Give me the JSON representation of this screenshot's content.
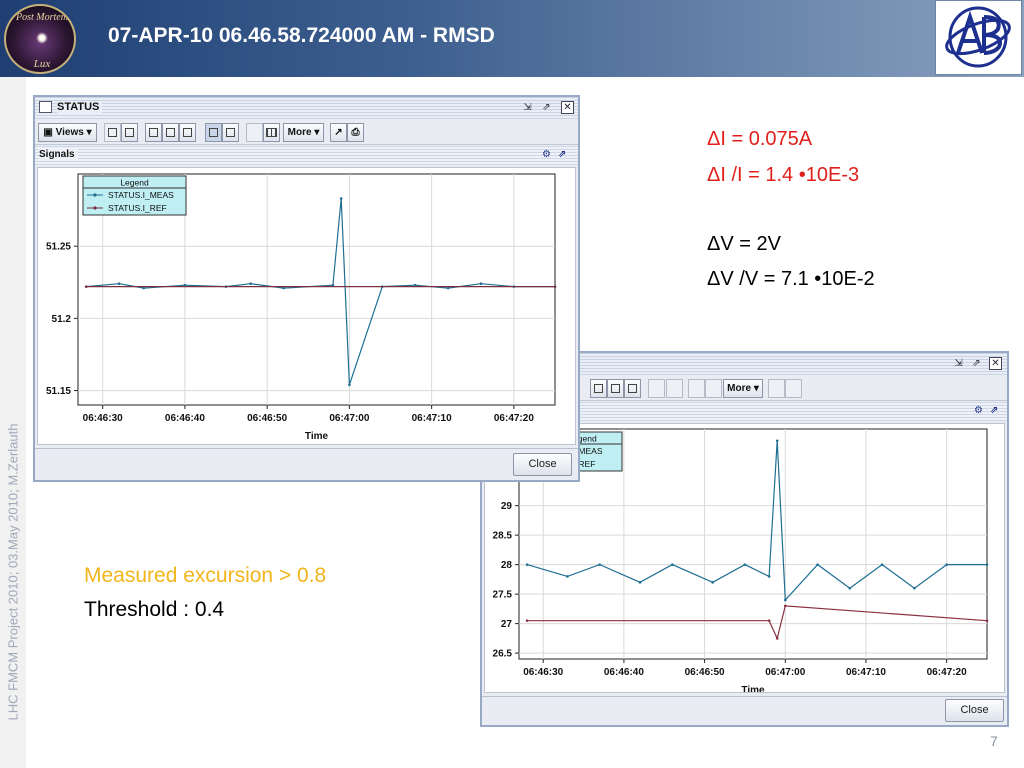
{
  "slide": {
    "title": "07-APR-10 06.46.58.724000 AM - RMSD",
    "logo_left": {
      "line1": "Post Mortem",
      "line2": "Lux"
    },
    "side_text": "LHC FMCM Project 2010; 03.May 2010; M.Zerlauth",
    "page_number": "7",
    "current_info": {
      "delta_i": "ΔI = 0.075A",
      "delta_i_ratio": "ΔI /I = 1.4 •10E-3"
    },
    "voltage_info": {
      "delta_v": "ΔV = 2V",
      "delta_v_ratio": "ΔV /V = 7.1 •10E-2"
    },
    "excursion": "Measured excursion > 0.8",
    "threshold": "Threshold : 0.4",
    "colors": {
      "header_dark": "#1f3f73",
      "red_text": "#e0201c",
      "yellow_text": "#f2b61c",
      "meas_series": "#1f6f93",
      "ref_series": "#8a3040"
    }
  },
  "window_status": {
    "title": "STATUS",
    "toolbar": {
      "views_label": "Views",
      "more_label": "More"
    },
    "section_title": "Signals",
    "close_label": "Close",
    "title_icons": [
      "minimize-icon",
      "maximize-icon",
      "close-icon"
    ]
  },
  "window_voltage": {
    "toolbar": {
      "more_label": "More"
    },
    "close_label": "Close",
    "title_icons": [
      "minimize-icon",
      "maximize-icon",
      "close-icon"
    ]
  },
  "chart_data": [
    {
      "type": "line",
      "title": "",
      "xlabel": "Time",
      "ylabel": "",
      "x_ticks": [
        "06:46:30",
        "06:46:40",
        "06:46:50",
        "06:47:00",
        "06:47:10",
        "06:47:20"
      ],
      "y_ticks": [
        "51.15",
        "51.2",
        "51.25"
      ],
      "ylim": [
        51.14,
        51.3
      ],
      "legend": {
        "title": "Legend",
        "position": "top-left",
        "entries": [
          "STATUS.I_MEAS",
          "STATUS.I_REF"
        ]
      },
      "grid": true,
      "series": [
        {
          "name": "STATUS.I_MEAS",
          "color": "#1f6f93",
          "x": [
            "06:46:28",
            "06:46:32",
            "06:46:35",
            "06:46:40",
            "06:46:45",
            "06:46:48",
            "06:46:52",
            "06:46:58",
            "06:46:59",
            "06:47:00",
            "06:47:04",
            "06:47:08",
            "06:47:12",
            "06:47:16",
            "06:47:20",
            "06:47:25"
          ],
          "values": [
            51.222,
            51.224,
            51.221,
            51.223,
            51.222,
            51.224,
            51.221,
            51.223,
            51.283,
            51.154,
            51.222,
            51.223,
            51.221,
            51.224,
            51.222,
            51.222
          ]
        },
        {
          "name": "STATUS.I_REF",
          "color": "#7a3040",
          "x": [
            "06:46:28",
            "06:47:25"
          ],
          "values": [
            51.222,
            51.222
          ]
        }
      ]
    },
    {
      "type": "line",
      "title": "",
      "xlabel": "Time",
      "ylabel": "",
      "x_ticks": [
        "06:46:30",
        "06:46:40",
        "06:46:50",
        "06:47:00",
        "06:47:10",
        "06:47:20"
      ],
      "y_ticks": [
        "26.5",
        "27",
        "27.5",
        "28",
        "28.5",
        "29"
      ],
      "ylim": [
        26.4,
        30.3
      ],
      "legend": {
        "title": "Legend",
        "position": "top-left",
        "entries": [
          "V_MEAS",
          "V_REF"
        ]
      },
      "grid": true,
      "series": [
        {
          "name": "V_MEAS",
          "color": "#1f6f93",
          "x": [
            "06:46:28",
            "06:46:33",
            "06:46:37",
            "06:46:42",
            "06:46:46",
            "06:46:51",
            "06:46:55",
            "06:46:58",
            "06:46:59",
            "06:47:00",
            "06:47:04",
            "06:47:08",
            "06:47:12",
            "06:47:16",
            "06:47:20",
            "06:47:25"
          ],
          "values": [
            28.0,
            27.8,
            28.0,
            27.7,
            28.0,
            27.7,
            28.0,
            27.8,
            30.1,
            27.4,
            28.0,
            27.6,
            28.0,
            27.6,
            28.0,
            28.0
          ]
        },
        {
          "name": "V_REF",
          "color": "#8a3040",
          "x": [
            "06:46:28",
            "06:46:58",
            "06:46:59",
            "06:47:00",
            "06:47:25"
          ],
          "values": [
            27.05,
            27.05,
            26.75,
            27.3,
            27.05
          ]
        }
      ]
    }
  ]
}
